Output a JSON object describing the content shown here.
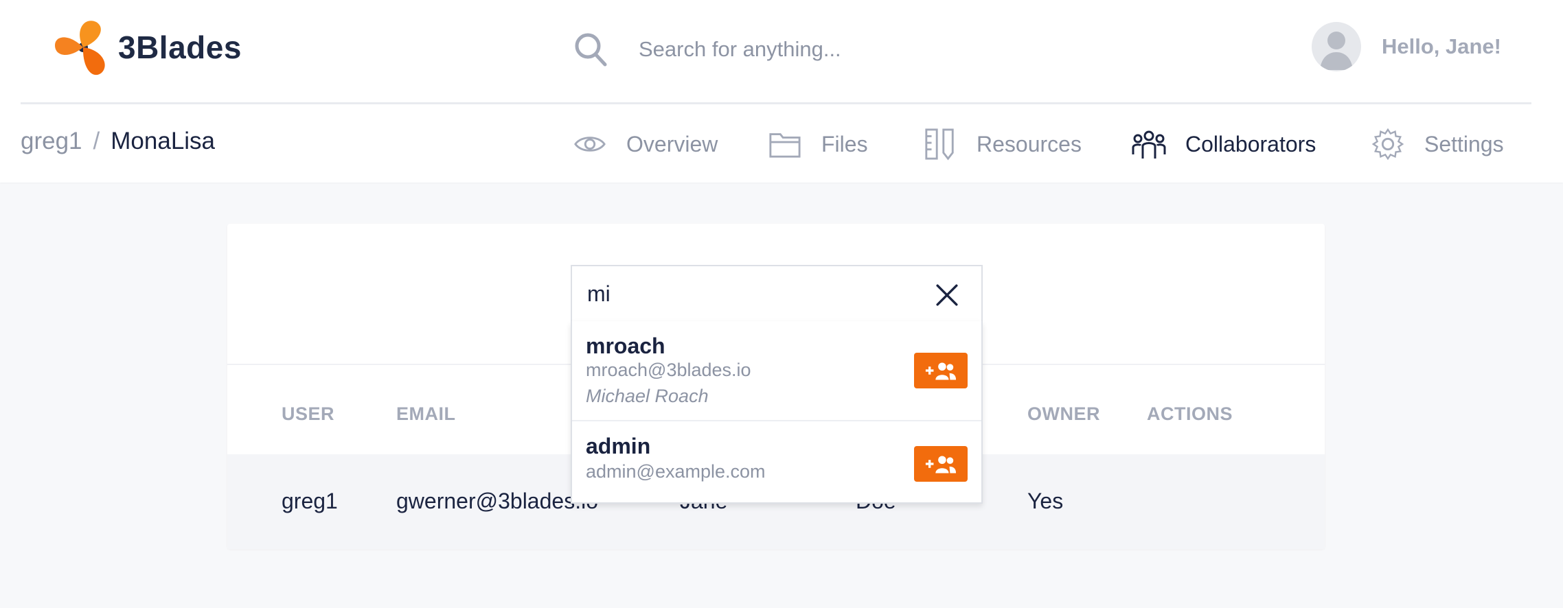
{
  "app": {
    "name": "3Blades"
  },
  "search": {
    "placeholder": "Search for anything..."
  },
  "user": {
    "greeting": "Hello, Jane!"
  },
  "breadcrumb": {
    "owner": "greg1",
    "separator": "/",
    "project": "MonaLisa"
  },
  "nav": {
    "tabs": [
      {
        "label": "Overview",
        "icon": "eye-icon",
        "active": false
      },
      {
        "label": "Files",
        "icon": "folder-icon",
        "active": false
      },
      {
        "label": "Resources",
        "icon": "ruler-pencil-icon",
        "active": false
      },
      {
        "label": "Collaborators",
        "icon": "people-icon",
        "active": true
      },
      {
        "label": "Settings",
        "icon": "gear-icon",
        "active": false
      }
    ]
  },
  "collab_search": {
    "value": "mi",
    "results": [
      {
        "username": "mroach",
        "email": "mroach@3blades.io",
        "full_name": "Michael Roach",
        "action_icon": "add-user-icon"
      },
      {
        "username": "admin",
        "email": "admin@example.com",
        "action_icon": "add-user-icon"
      }
    ]
  },
  "table": {
    "headers": [
      "USER",
      "EMAIL",
      "OWNER",
      "ACTIONS"
    ],
    "rows": [
      {
        "user": "greg1",
        "email": "gwerner@3blades.io",
        "first_name": "Jane",
        "last_name": "Doe",
        "owner": "Yes"
      }
    ]
  },
  "colors": {
    "accent": "#f26c0d",
    "text_dark": "#1a2340",
    "text_muted": "#8c93a3"
  }
}
